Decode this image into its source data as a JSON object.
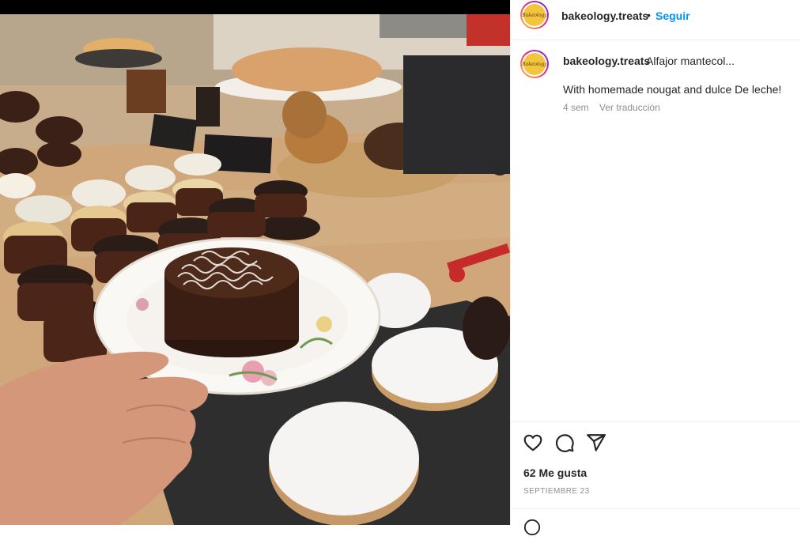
{
  "post": {
    "username": "bakeology.treats",
    "separator": "•",
    "follow_label": "Seguir",
    "avatar_logo_text": "Bakeology",
    "caption_username": "bakeology.treats",
    "caption_text": "Alfajor mantecol...",
    "caption_line2": "With homemade nougat and dulce De leche!",
    "time_ago": "4 sem",
    "translate_label": "Ver traducción",
    "likes": "62 Me gusta",
    "date": "SEPTIEMBRE 23"
  },
  "icons": {
    "like": "heart-icon",
    "comment": "comment-icon",
    "share": "share-icon",
    "emoji": "emoji-icon"
  },
  "colors": {
    "accent": "#0095f6",
    "text": "#262626",
    "muted": "#8e8e8e"
  }
}
